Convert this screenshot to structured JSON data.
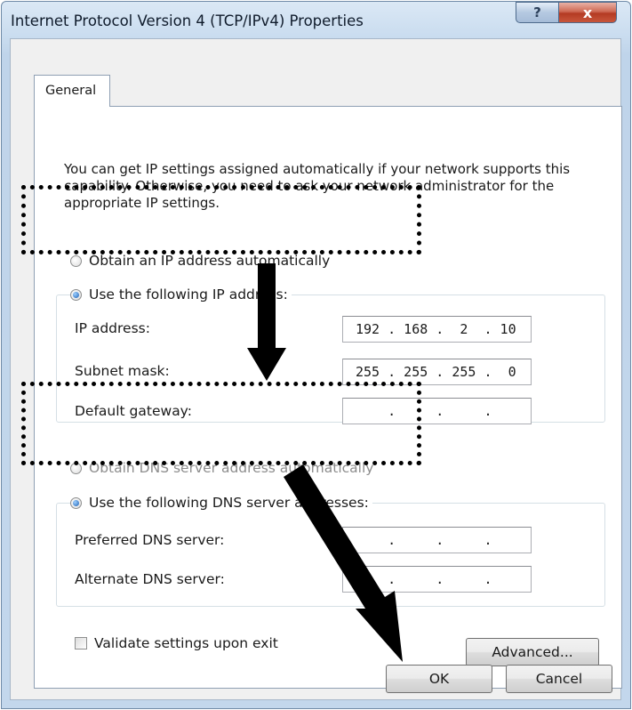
{
  "window": {
    "title": "Internet Protocol Version 4 (TCP/IPv4) Properties",
    "help_glyph": "?",
    "close_glyph": "x"
  },
  "tabs": [
    {
      "label": "General",
      "selected": true
    }
  ],
  "description": "You can get IP settings assigned automatically if your network supports this capability. Otherwise, you need to ask your network administrator for the appropriate IP settings.",
  "ip_section": {
    "auto_label": "Obtain an IP address automatically",
    "manual_label": "Use the following IP address:",
    "selected": "manual",
    "fields": [
      {
        "label": "IP address:",
        "value": "192 . 168 .  2  . 10"
      },
      {
        "label": "Subnet mask:",
        "value": "255 . 255 . 255 .  0"
      },
      {
        "label": "Default gateway:",
        "value": "    .     .     ."
      }
    ]
  },
  "dns_section": {
    "auto_label": "Obtain DNS server address automatically",
    "manual_label": "Use the following DNS server addresses:",
    "selected": "manual",
    "fields": [
      {
        "label": "Preferred DNS server:",
        "value": "    .     .     ."
      },
      {
        "label": "Alternate DNS server:",
        "value": "    .     .     ."
      }
    ]
  },
  "validate_label": "Validate settings upon exit",
  "buttons": {
    "advanced": "Advanced...",
    "ok": "OK",
    "cancel": "Cancel"
  }
}
